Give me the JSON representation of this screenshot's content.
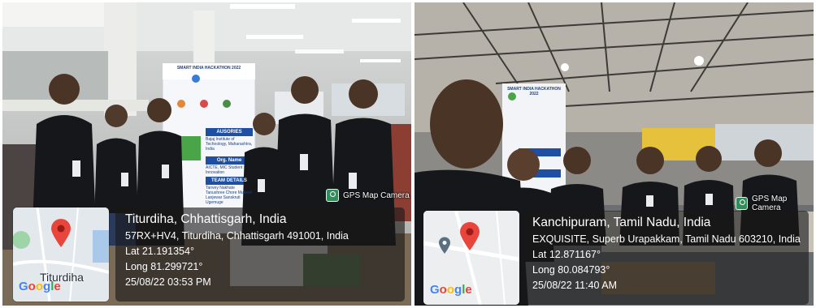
{
  "photos": [
    {
      "camera_badge": {
        "icon": "gps-map-camera-icon",
        "label": "GPS Map Camera"
      },
      "map": {
        "label": "Titurdiha"
      },
      "location": {
        "place": "Titurdiha, Chhattisgarh, India",
        "address": "57RX+HV4, Titurdiha, Chhattisgarh 491001, India",
        "lat": "Lat 21.191354°",
        "long": "Long 81.299721°",
        "datetime": "25/08/22 03:53 PM"
      },
      "banner": {
        "title": "SMART INDIA HACKATHON 2022",
        "auspices_heading": "AUSORIES",
        "auspices_text": "Bajaj Institute of Technology, Maharashtra, India",
        "org_heading": "Org. Name",
        "org_text": "AICTE, MIC Student Innovation",
        "team_heading": "TEAM DETAILS",
        "team_text": "Tanvey Nakhate Tanushree Chore Mukesh Lanjewar Sanskruti Ugemuge"
      }
    },
    {
      "camera_badge": {
        "icon": "gps-map-camera-icon",
        "label": "GPS Map Camera"
      },
      "map": {
        "label": ""
      },
      "location": {
        "place": "Kanchipuram, Tamil Nadu, India",
        "address": "EXQUISITE, Superb Urapakkam, Tamil Nadu 603210, India",
        "lat": "Lat 12.871167°",
        "long": "Long 80.084793°",
        "datetime": "25/08/22 11:40 AM"
      },
      "banner": {
        "title": "SMART INDIA HACKATHON 2022"
      }
    }
  ],
  "google_letters": [
    "G",
    "o",
    "o",
    "g",
    "l",
    "e"
  ],
  "colors": {
    "map_pin": "#e8453c",
    "panel_bg": "#191919",
    "shirt": "#15171a"
  }
}
